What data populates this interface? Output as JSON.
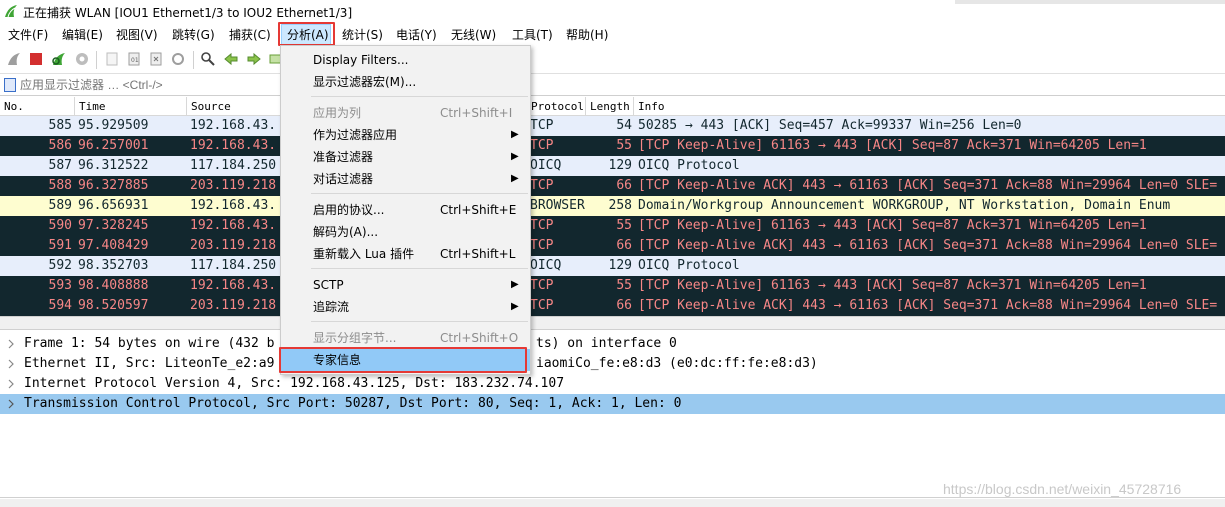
{
  "window": {
    "title": "正在捕获 WLAN [IOU1 Ethernet1/3 to IOU2 Ethernet1/3]"
  },
  "menubar": {
    "items": [
      "文件(F)",
      "编辑(E)",
      "视图(V)",
      "跳转(G)",
      "捕获(C)",
      "分析(A)",
      "统计(S)",
      "电话(Y)",
      "无线(W)",
      "工具(T)",
      "帮助(H)"
    ],
    "active": "分析(A)"
  },
  "filter": {
    "placeholder": "应用显示过滤器 … <Ctrl-/>"
  },
  "packet_list": {
    "columns": [
      "No.",
      "Time",
      "Source",
      "Protocol",
      "Length",
      "Info"
    ],
    "rows": [
      {
        "no": "585",
        "time": "95.929509",
        "source": "192.168.43.",
        "protocol": "TCP",
        "length": "54",
        "info": "50285 → 443 [ACK] Seq=457 Ack=99337 Win=256 Len=0",
        "style": "light"
      },
      {
        "no": "586",
        "time": "96.257001",
        "source": "192.168.43.",
        "protocol": "TCP",
        "length": "55",
        "info": "[TCP Keep-Alive] 61163 → 443 [ACK] Seq=87 Ack=371 Win=64205 Len=1",
        "style": "dark"
      },
      {
        "no": "587",
        "time": "96.312522",
        "source": "117.184.250",
        "protocol": "OICQ",
        "length": "129",
        "info": "OICQ Protocol",
        "style": "light"
      },
      {
        "no": "588",
        "time": "96.327885",
        "source": "203.119.218",
        "protocol": "TCP",
        "length": "66",
        "info": "[TCP Keep-Alive ACK] 443 → 61163 [ACK] Seq=371 Ack=88 Win=29964 Len=0 SLE=",
        "style": "dark"
      },
      {
        "no": "589",
        "time": "96.656931",
        "source": "192.168.43.",
        "protocol": "BROWSER",
        "length": "258",
        "info": "Domain/Workgroup Announcement WORKGROUP, NT Workstation, Domain Enum",
        "style": "yellow"
      },
      {
        "no": "590",
        "time": "97.328245",
        "source": "192.168.43.",
        "protocol": "TCP",
        "length": "55",
        "info": "[TCP Keep-Alive] 61163 → 443 [ACK] Seq=87 Ack=371 Win=64205 Len=1",
        "style": "dark"
      },
      {
        "no": "591",
        "time": "97.408429",
        "source": "203.119.218",
        "protocol": "TCP",
        "length": "66",
        "info": "[TCP Keep-Alive ACK] 443 → 61163 [ACK] Seq=371 Ack=88 Win=29964 Len=0 SLE=",
        "style": "dark"
      },
      {
        "no": "592",
        "time": "98.352703",
        "source": "117.184.250",
        "protocol": "OICQ",
        "length": "129",
        "info": "OICQ Protocol",
        "style": "light"
      },
      {
        "no": "593",
        "time": "98.408888",
        "source": "192.168.43.",
        "protocol": "TCP",
        "length": "55",
        "info": "[TCP Keep-Alive] 61163 → 443 [ACK] Seq=87 Ack=371 Win=64205 Len=1",
        "style": "dark"
      },
      {
        "no": "594",
        "time": "98.520597",
        "source": "203.119.218",
        "protocol": "TCP",
        "length": "66",
        "info": "[TCP Keep-Alive ACK] 443 → 61163 [ACK] Seq=371 Ack=88 Win=29964 Len=0 SLE=",
        "style": "dark"
      }
    ]
  },
  "details": {
    "rows": [
      {
        "text": "Frame 1: 54 bytes on wire (432 b",
        "tail": "ts) on interface 0",
        "selected": false
      },
      {
        "text": "Ethernet II, Src: LiteonTe_e2:a9",
        "tail": "iaomiCo_fe:e8:d3 (e0:dc:ff:fe:e8:d3)",
        "selected": false
      },
      {
        "text": "Internet Protocol Version 4, Src: 192.168.43.125, Dst: 183.232.74.107",
        "tail": "",
        "selected": false
      },
      {
        "text": "Transmission Control Protocol, Src Port: 50287, Dst Port: 80, Seq: 1, Ack: 1, Len: 0",
        "tail": "",
        "selected": true
      }
    ]
  },
  "dropdown": {
    "items": [
      {
        "label": "Display Filters...",
        "shortcut": "",
        "arrow": false,
        "disabled": false
      },
      {
        "label": "显示过滤器宏(M)...",
        "shortcut": "",
        "arrow": false,
        "disabled": false
      },
      {
        "label": "应用为列",
        "shortcut": "Ctrl+Shift+I",
        "arrow": false,
        "disabled": true
      },
      {
        "label": "作为过滤器应用",
        "shortcut": "",
        "arrow": true,
        "disabled": false
      },
      {
        "label": "准备过滤器",
        "shortcut": "",
        "arrow": true,
        "disabled": false
      },
      {
        "label": "对话过滤器",
        "shortcut": "",
        "arrow": true,
        "disabled": false
      },
      {
        "label": "启用的协议...",
        "shortcut": "Ctrl+Shift+E",
        "arrow": false,
        "disabled": false
      },
      {
        "label": "解码为(A)...",
        "shortcut": "",
        "arrow": false,
        "disabled": false
      },
      {
        "label": "重新载入 Lua 插件",
        "shortcut": "Ctrl+Shift+L",
        "arrow": false,
        "disabled": false
      },
      {
        "label": "SCTP",
        "shortcut": "",
        "arrow": true,
        "disabled": false
      },
      {
        "label": "追踪流",
        "shortcut": "",
        "arrow": true,
        "disabled": false
      },
      {
        "label": "显示分组字节...",
        "shortcut": "Ctrl+Shift+O",
        "arrow": false,
        "disabled": true
      },
      {
        "label": "专家信息",
        "shortcut": "",
        "arrow": false,
        "disabled": false
      }
    ],
    "hovered": "专家信息"
  },
  "watermark": "https://blog.csdn.net/weixin_45728716",
  "colors": {
    "light_row": "#e7eefb",
    "dark_row": "#12272e",
    "dark_row_text": "#f78787",
    "yellow_row": "#fefdd0",
    "selected_detail": "#99c9ef",
    "menu_hover": "#91c9f7",
    "highlight_box": "#e53935"
  }
}
